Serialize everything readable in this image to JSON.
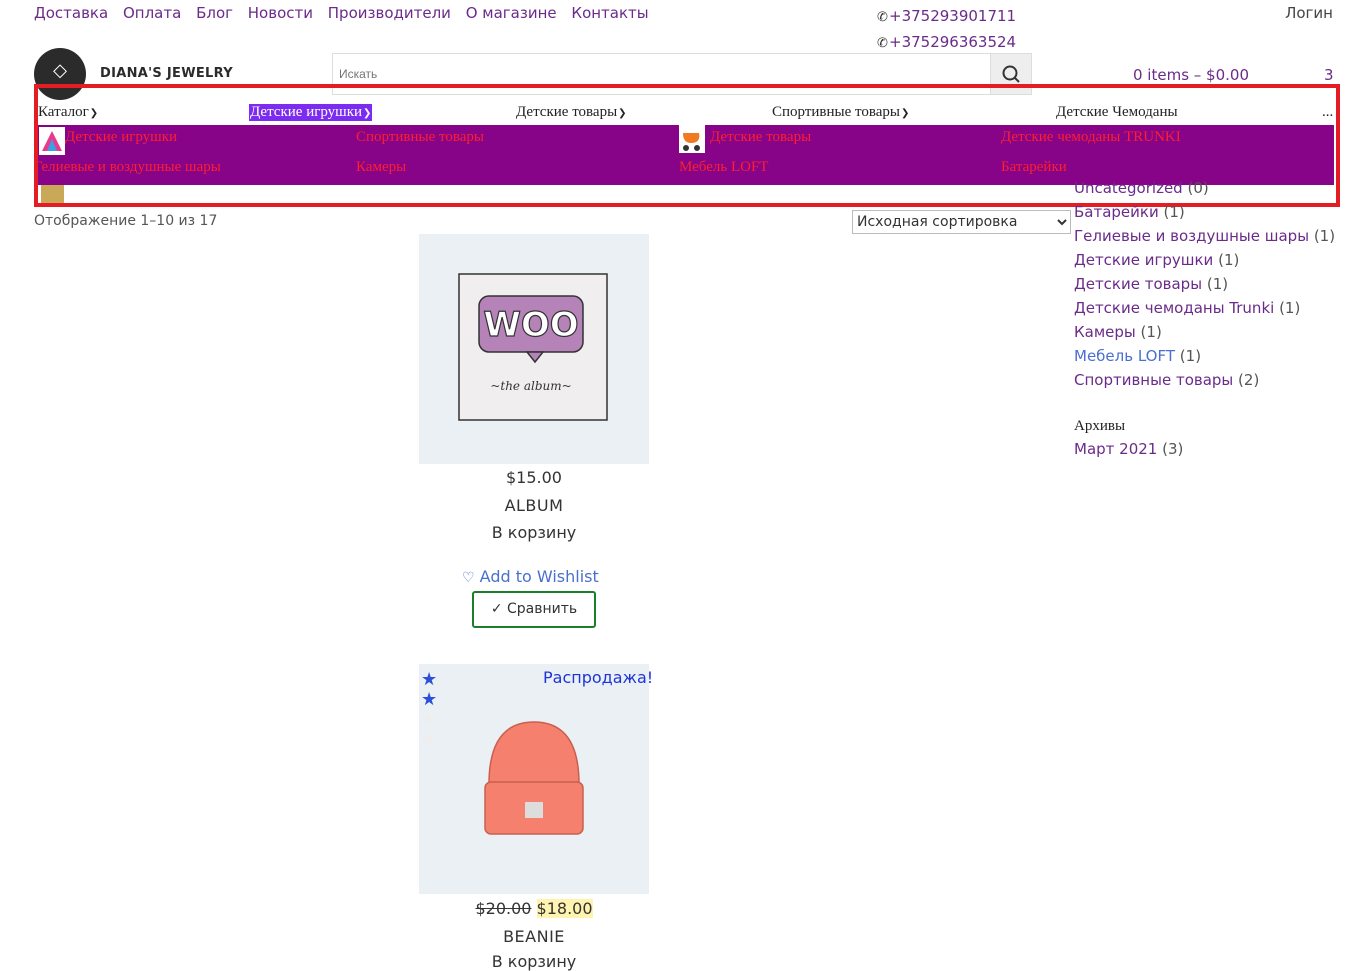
{
  "topnav": {
    "items": [
      "Доставка",
      "Оплата",
      "Блог",
      "Новости",
      "Производители",
      "О магазине",
      "Контакты"
    ],
    "phones": [
      "+375293901711",
      "+375296363524"
    ],
    "login": "Логин"
  },
  "brand": "DIANA'S JEWELRY",
  "search": {
    "placeholder": "Искать"
  },
  "cart": {
    "summary": "0 items – $0.00",
    "count": "3"
  },
  "menu": {
    "items": [
      "Каталог",
      "Детские игрушки",
      "Детские товары",
      "Спортивные товары",
      "Детские Чемоданы",
      "..."
    ],
    "submenu": [
      "Детские игрушки",
      "Спортивные товары",
      "Детские товары",
      "Детские чемоданы TRUNKI",
      "Гелиевые и воздушные шары",
      "Камеры",
      "Мебель LOFT",
      "Батарейки"
    ]
  },
  "results_count": "Отображение 1–10 из 17",
  "sort": {
    "selected": "Исходная сортировка"
  },
  "products": [
    {
      "price": "$15.00",
      "title": "ALBUM",
      "cart": "В корзину",
      "wishlist": "Add to Wishlist",
      "compare": "✓ Сравнить"
    },
    {
      "sale": "Распродажа!",
      "old_price": "$20.00",
      "new_price": "$18.00",
      "title": "BEANIE",
      "cart": "В корзину"
    }
  ],
  "categories": [
    {
      "name": "Uncategorized",
      "count": "(0)"
    },
    {
      "name": "Батарейки",
      "count": "(1)"
    },
    {
      "name": "Гелиевые и воздушные шары",
      "count": "(1)"
    },
    {
      "name": "Детские игрушки",
      "count": "(1)"
    },
    {
      "name": "Детские товары",
      "count": "(1)"
    },
    {
      "name": "Детские чемоданы Trunki",
      "count": "(1)"
    },
    {
      "name": "Камеры",
      "count": "(1)"
    },
    {
      "name": "Мебель LOFT",
      "count": "(1)"
    },
    {
      "name": "Спортивные товары",
      "count": "(2)"
    }
  ],
  "archives": {
    "title": "Архивы",
    "items": [
      {
        "name": "Март 2021",
        "count": "(3)"
      }
    ]
  },
  "colors": {
    "accent": "#6a2b8a",
    "submenu_bg": "#870387",
    "submenu_text": "#ff1f2e",
    "active_menu": "#7b2cf0",
    "highlight_frame": "#e41c24"
  }
}
